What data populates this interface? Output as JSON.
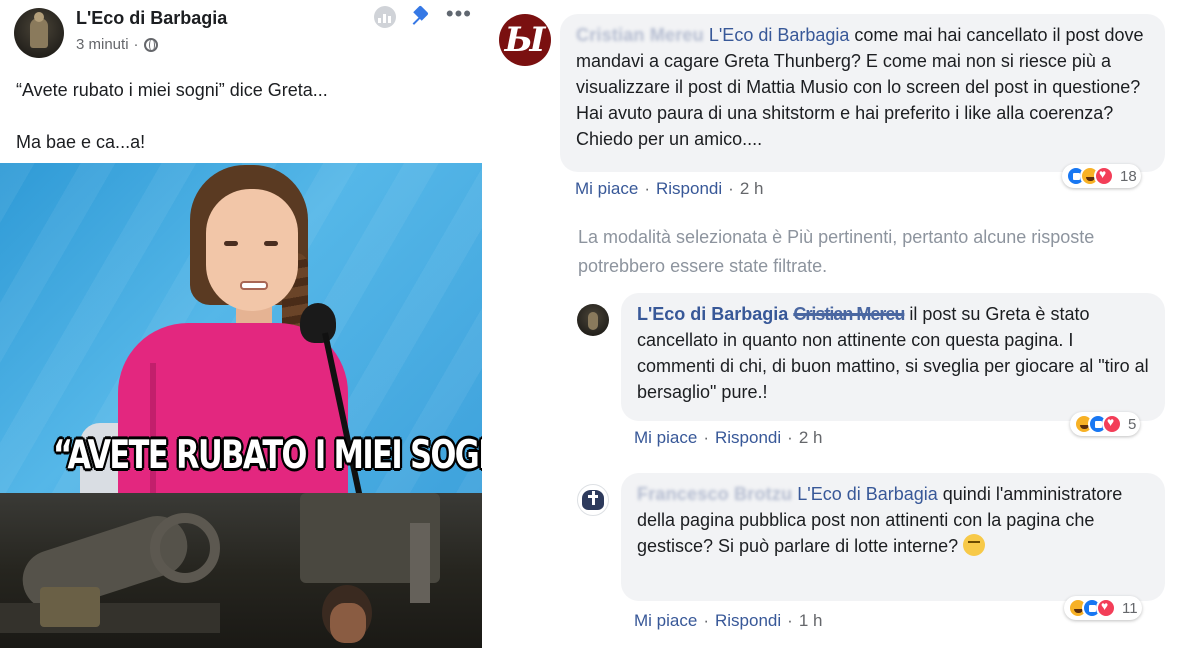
{
  "post": {
    "page_name": "L'Eco di Barbagia",
    "time": "3 minuti",
    "dot": "·",
    "text_line1": "“Avete rubato i miei sogni” dice Greta...",
    "text_line2": "Ma bae e ca...a!",
    "meme_caption": "“AVETE RUBATO I MIEI SOGNI”",
    "icons": [
      "insights-icon",
      "pin-icon",
      "more-icon",
      "globe-icon"
    ],
    "more_label": "•••"
  },
  "comments": [
    {
      "author": "Cristian Mereu",
      "tag": "L'Eco di Barbagia",
      "text": " come mai hai cancellato il post dove mandavi a cagare Greta Thunberg? E come mai non si riesce più a visualizzare il post di Mattia Musio con lo screen del post in questione? Hai avuto paura di una shitstorm e hai preferito i like alla coerenza? Chiedo per un amico....",
      "like": "Mi piace",
      "reply": "Rispondi",
      "time": "2 h",
      "reaction_count": "18"
    },
    {
      "author": "L'Eco di Barbagia",
      "tag": "Cristian Mereu",
      "text": " il post su Greta è stato cancellato in quanto non attinente con questa pagina. I commenti di chi, di buon mattino, si sveglia per giocare al \"tiro al bersaglio\" pure.!",
      "like": "Mi piace",
      "reply": "Rispondi",
      "time": "2 h",
      "reaction_count": "5"
    },
    {
      "author": "Francesco Brotzu",
      "tag": "L'Eco di Barbagia",
      "text": " quindi l'amministratore della pagina pubblica post non attinenti con la pagina che gestisce? Si può parlare di lotte interne? ",
      "like": "Mi piace",
      "reply": "Rispondi",
      "time": "1 h",
      "reaction_count": "11"
    }
  ],
  "sep": "·",
  "filter_note": "La modalità selezionata è Più pertinenti, pertanto alcune risposte potrebbero essere state filtrate.",
  "avatar_cristian_letter": "Ы",
  "colors": {
    "link": "#385898",
    "bubble": "#f2f3f5",
    "muted": "#65676b",
    "like": "#1877f2",
    "love": "#f33e58",
    "haha": "#f7b125"
  }
}
